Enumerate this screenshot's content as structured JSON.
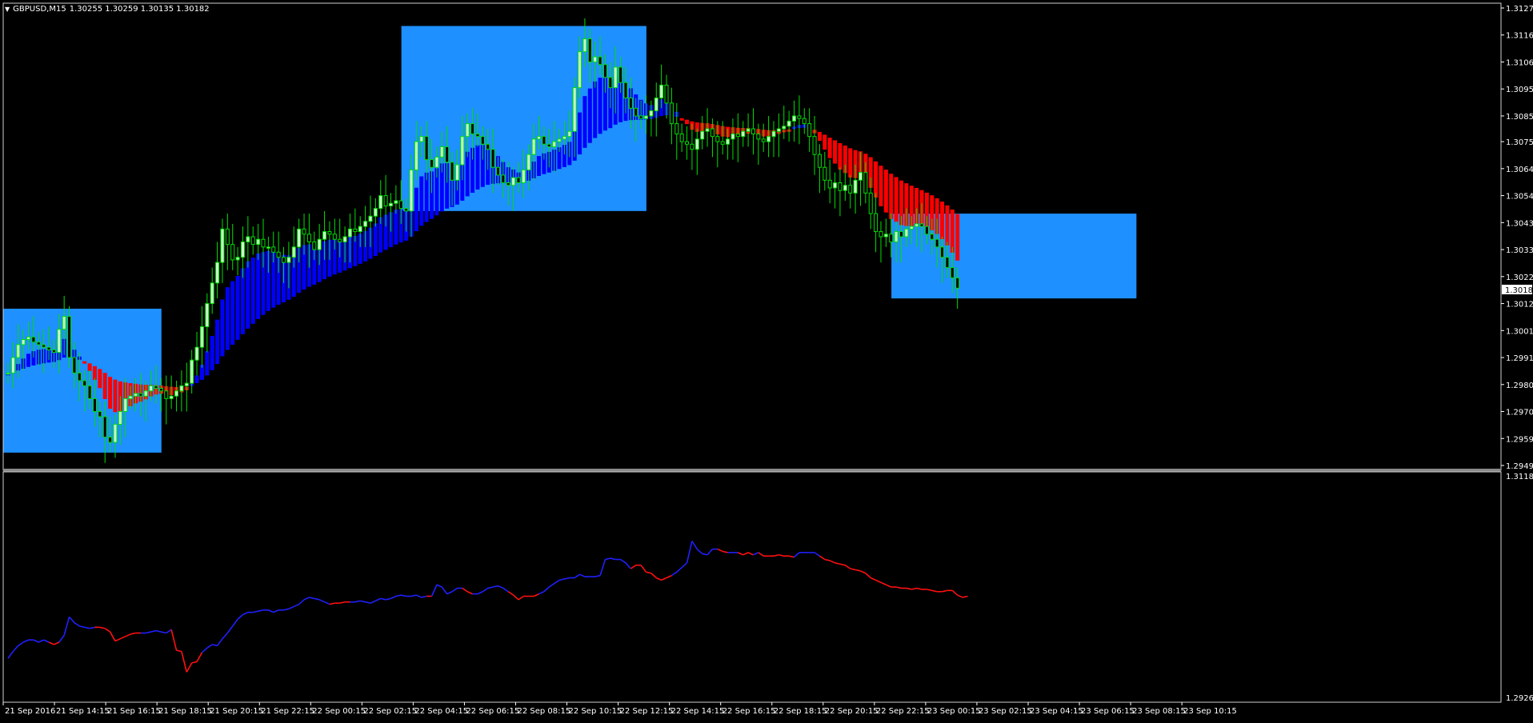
{
  "header": {
    "symbol": "GBPUSD,M15",
    "ohlc": "1.30255 1.30259 1.30135 1.30182"
  },
  "price_axis": {
    "labels": [
      "1.31270",
      "1.31165",
      "1.31060",
      "1.30955",
      "1.30850",
      "1.30750",
      "1.30645",
      "1.30540",
      "1.30435",
      "1.30330",
      "1.30225",
      "1.30120",
      "1.30015",
      "1.29910",
      "1.29805",
      "1.29700",
      "1.29595",
      "1.29490"
    ],
    "current_price": "1.30182"
  },
  "indicator_axis": {
    "top": "1.3118",
    "bottom": "1.2926"
  },
  "time_axis": {
    "labels": [
      "21 Sep 2016",
      "21 Sep 14:15",
      "21 Sep 16:15",
      "21 Sep 18:15",
      "21 Sep 20:15",
      "21 Sep 22:15",
      "22 Sep 00:15",
      "22 Sep 02:15",
      "22 Sep 04:15",
      "22 Sep 06:15",
      "22 Sep 08:15",
      "22 Sep 10:15",
      "22 Sep 12:15",
      "22 Sep 14:15",
      "22 Sep 16:15",
      "22 Sep 18:15",
      "22 Sep 20:15",
      "22 Sep 22:15",
      "23 Sep 00:15",
      "23 Sep 02:15",
      "23 Sep 04:15",
      "23 Sep 06:15",
      "23 Sep 08:15",
      "23 Sep 10:15"
    ]
  },
  "colors": {
    "background": "#000000",
    "zone": "#1e90ff",
    "bull": "#c8ffc8",
    "bear": "#000000",
    "wick": "#00e000",
    "band_up": "#0000ff",
    "band_down": "#ff0000",
    "line_up": "#2020ff",
    "line_down": "#ff1010",
    "grid_text": "#ffffff"
  },
  "chart_data": {
    "type": "candlestick",
    "symbol": "GBPUSD",
    "timeframe": "M15",
    "ylim": [
      1.2949,
      1.3127
    ],
    "zones": [
      {
        "x0": 0,
        "x1": 31,
        "y_top": 1.301,
        "y_bottom": 1.2954
      },
      {
        "x0": 78,
        "x1": 126,
        "y_top": 1.312,
        "y_bottom": 1.3048
      },
      {
        "x0": 174,
        "x1": 222,
        "y_top": 1.3047,
        "y_bottom": 1.3014
      }
    ],
    "close": [
      1.2985,
      1.2991,
      1.2996,
      1.2998,
      1.2999,
      1.2997,
      1.2996,
      1.2995,
      1.2994,
      1.2993,
      1.3002,
      1.3007,
      1.2991,
      1.2985,
      1.2982,
      1.298,
      1.2975,
      1.297,
      1.2968,
      1.296,
      1.2958,
      1.2965,
      1.297,
      1.2975,
      1.2976,
      1.2977,
      1.2976,
      1.2978,
      1.298,
      1.2979,
      1.2978,
      1.2975,
      1.2976,
      1.2978,
      1.298,
      1.2981,
      1.299,
      1.2995,
      1.3003,
      1.3012,
      1.302,
      1.3028,
      1.3041,
      1.3035,
      1.3029,
      1.303,
      1.3036,
      1.3038,
      1.3035,
      1.3037,
      1.3034,
      1.3034,
      1.3032,
      1.303,
      1.3028,
      1.303,
      1.3034,
      1.3041,
      1.3039,
      1.3036,
      1.3033,
      1.3037,
      1.304,
      1.3039,
      1.3037,
      1.3036,
      1.3038,
      1.3041,
      1.304,
      1.3042,
      1.3044,
      1.3046,
      1.3049,
      1.3054,
      1.305,
      1.3051,
      1.3052,
      1.3049,
      1.3048,
      1.3064,
      1.3075,
      1.3077,
      1.3068,
      1.3065,
      1.3069,
      1.3073,
      1.3067,
      1.306,
      1.3066,
      1.3077,
      1.3082,
      1.3078,
      1.3077,
      1.3074,
      1.3072,
      1.3065,
      1.3062,
      1.3059,
      1.3058,
      1.3061,
      1.3059,
      1.3064,
      1.307,
      1.3076,
      1.3077,
      1.3074,
      1.3073,
      1.3075,
      1.3076,
      1.3077,
      1.3079,
      1.3096,
      1.311,
      1.3115,
      1.3106,
      1.3108,
      1.3105,
      1.31,
      1.3096,
      1.3104,
      1.3098,
      1.3092,
      1.3088,
      1.3085,
      1.3084,
      1.3085,
      1.3087,
      1.3092,
      1.3097,
      1.309,
      1.3082,
      1.3078,
      1.3075,
      1.3074,
      1.3072,
      1.3076,
      1.3079,
      1.308,
      1.3077,
      1.3075,
      1.3074,
      1.3076,
      1.3078,
      1.3077,
      1.3079,
      1.308,
      1.3078,
      1.3076,
      1.3075,
      1.3077,
      1.3079,
      1.308,
      1.3081,
      1.3083,
      1.3085,
      1.3084,
      1.3082,
      1.3077,
      1.307,
      1.3065,
      1.306,
      1.3057,
      1.3059,
      1.3056,
      1.3058,
      1.3055,
      1.306,
      1.3063,
      1.3055,
      1.3047,
      1.304,
      1.3038,
      1.3039,
      1.3036,
      1.304,
      1.3038,
      1.3041,
      1.3042,
      1.3043,
      1.3042,
      1.3039,
      1.3037,
      1.3034,
      1.303,
      1.3026,
      1.3022,
      1.3018
    ],
    "indicator": {
      "ylim": [
        1.2926,
        1.3118
      ],
      "values": [
        1.296,
        1.2966,
        1.2971,
        1.2974,
        1.2976,
        1.2976,
        1.2974,
        1.2976,
        1.2974,
        1.2972,
        1.2974,
        1.298,
        1.2996,
        1.2991,
        1.2988,
        1.2987,
        1.2986,
        1.2987,
        1.2987,
        1.2986,
        1.2983,
        1.2975,
        1.2977,
        1.2979,
        1.2981,
        1.2982,
        1.2982,
        1.2982,
        1.2983,
        1.2984,
        1.2983,
        1.2982,
        1.2985,
        1.2967,
        1.2966,
        1.2948,
        1.2956,
        1.2957,
        1.2965,
        1.2969,
        1.2972,
        1.2971,
        1.2977,
        1.2982,
        1.2988,
        1.2994,
        1.2998,
        1.3,
        1.3,
        1.3001,
        1.3002,
        1.3002,
        1.3,
        1.3002,
        1.3002,
        1.3003,
        1.3005,
        1.3007,
        1.3011,
        1.3013,
        1.3012,
        1.3011,
        1.3009,
        1.3007,
        1.3008,
        1.3008,
        1.3009,
        1.3009,
        1.3009,
        1.301,
        1.3009,
        1.3008,
        1.301,
        1.3012,
        1.3011,
        1.3012,
        1.3014,
        1.3015,
        1.3014,
        1.3014,
        1.3015,
        1.3013,
        1.3014,
        1.3014,
        1.3024,
        1.3022,
        1.3016,
        1.3018,
        1.3021,
        1.3021,
        1.3018,
        1.3016,
        1.3016,
        1.3018,
        1.3021,
        1.3022,
        1.3023,
        1.3021,
        1.3018,
        1.3015,
        1.3011,
        1.3014,
        1.3014,
        1.3014,
        1.3016,
        1.3018,
        1.3022,
        1.3025,
        1.3028,
        1.3029,
        1.303,
        1.303,
        1.3033,
        1.3031,
        1.3031,
        1.3031,
        1.3032,
        1.3046,
        1.3047,
        1.3046,
        1.3046,
        1.3043,
        1.3038,
        1.3041,
        1.3041,
        1.3035,
        1.3034,
        1.303,
        1.3028,
        1.303,
        1.3032,
        1.3035,
        1.3039,
        1.3043,
        1.3062,
        1.3055,
        1.3051,
        1.305,
        1.3055,
        1.3055,
        1.3053,
        1.3052,
        1.3052,
        1.3052,
        1.305,
        1.3052,
        1.305,
        1.3052,
        1.3049,
        1.3049,
        1.3049,
        1.305,
        1.3049,
        1.3049,
        1.3048,
        1.3052,
        1.3052,
        1.3052,
        1.3052,
        1.3049,
        1.3046,
        1.3045,
        1.3043,
        1.3042,
        1.3041,
        1.3038,
        1.3037,
        1.3036,
        1.3034,
        1.303,
        1.3028,
        1.3026,
        1.3024,
        1.3022,
        1.3022,
        1.3021,
        1.3021,
        1.302,
        1.3021,
        1.302,
        1.302,
        1.3019,
        1.3018,
        1.3018,
        1.3019,
        1.3019,
        1.3015,
        1.3013,
        1.3014
      ]
    }
  }
}
